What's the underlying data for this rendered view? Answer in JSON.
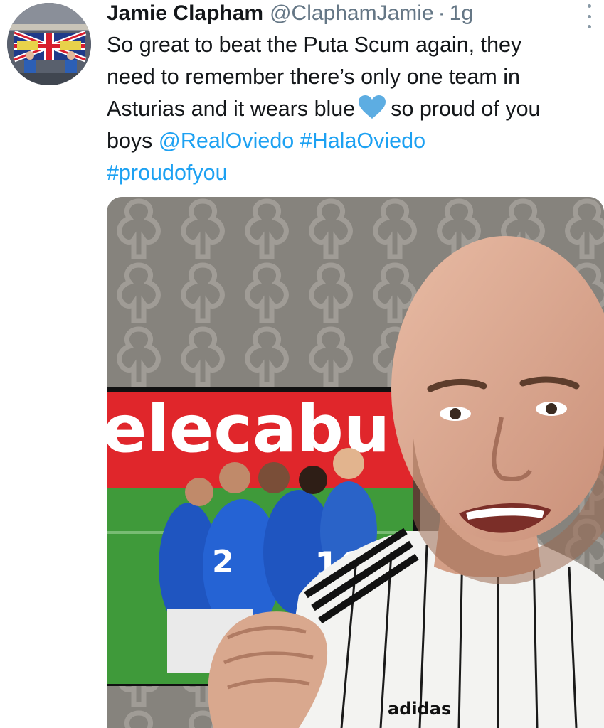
{
  "tweet": {
    "author": {
      "display_name": "Jamie Clapham",
      "handle": "@ClaphamJamie",
      "separator": "·",
      "time": "1g"
    },
    "text": {
      "line1": "So great to beat the Puta Scum again, they",
      "line2": "need to remember there’s only one team in",
      "line3_before": "Asturias and it wears blue",
      "line3_after": "so proud of you",
      "line4_before": "boys",
      "mention": "@RealOviedo",
      "hashtag1": "#HalaOviedo",
      "hashtag2": "#proudofyou"
    },
    "emoji": "blue-heart-emoji",
    "media": {
      "tv_banner_text": "elecabu",
      "jersey_numbers": [
        "2",
        "16"
      ],
      "jersey_brand": "adidas"
    }
  },
  "colors": {
    "link": "#1da1f2",
    "secondary_text": "#657786",
    "heart": "#5dade2"
  },
  "icons": {
    "more_menu": "more-vertical-icon"
  }
}
